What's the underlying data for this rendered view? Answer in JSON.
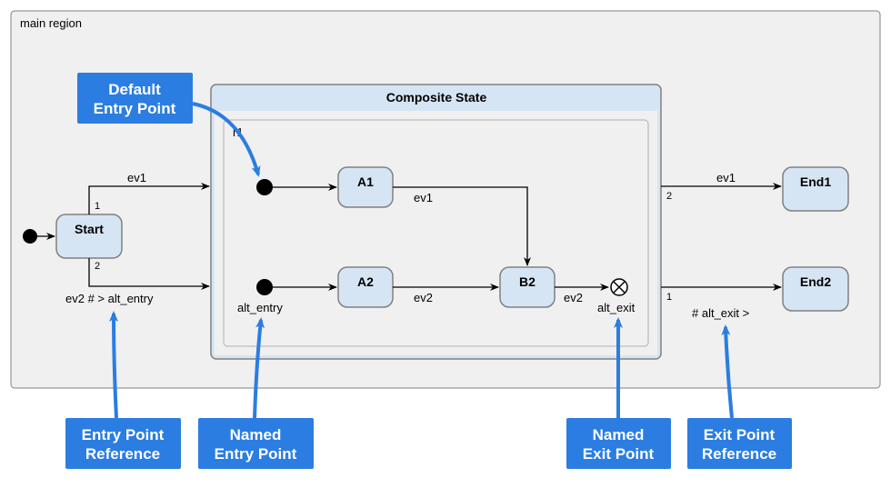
{
  "region": {
    "label": "main region"
  },
  "composite": {
    "title": "Composite State",
    "innerRegionLabel": "r1",
    "altEntryLabel": "alt_entry",
    "altExitLabel": "alt_exit"
  },
  "states": {
    "start": "Start",
    "a1": "A1",
    "a2": "A2",
    "b2": "B2",
    "end1": "End1",
    "end2": "End2"
  },
  "transitions": {
    "start_to_comp_top": {
      "label": "ev1",
      "priority": "1"
    },
    "start_to_comp_bottom": {
      "label": "ev2 # > alt_entry",
      "priority": "2"
    },
    "a1_to_b2": {
      "label": "ev1"
    },
    "a2_to_b2": {
      "label": "ev2"
    },
    "b2_to_exit": {
      "label": "ev2"
    },
    "comp_to_end1": {
      "label": "ev1",
      "priority": "2"
    },
    "comp_to_end2": {
      "label": "# alt_exit >",
      "priority": "1"
    }
  },
  "callouts": {
    "defaultEntry": {
      "line1": "Default",
      "line2": "Entry Point"
    },
    "entryRef": {
      "line1": "Entry Point",
      "line2": "Reference"
    },
    "namedEntry": {
      "line1": "Named",
      "line2": "Entry Point"
    },
    "namedExit": {
      "line1": "Named",
      "line2": "Exit Point"
    },
    "exitRef": {
      "line1": "Exit Point",
      "line2": "Reference"
    }
  }
}
